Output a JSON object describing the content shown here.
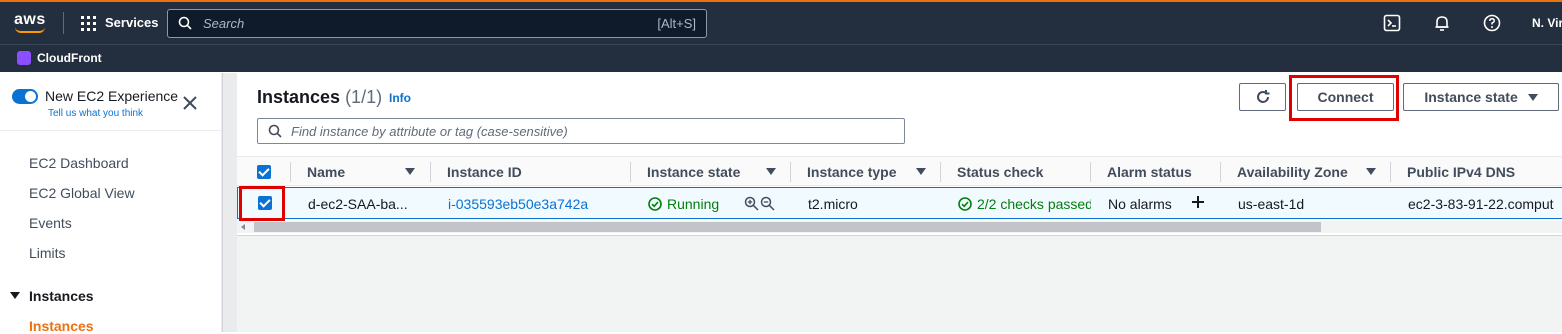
{
  "topbar": {
    "logo": "aws",
    "services_label": "Services",
    "search_placeholder": "Search",
    "search_shortcut": "[Alt+S]",
    "region": "N. Vir",
    "service_favorite": "CloudFront"
  },
  "sidebar": {
    "experience_title": "New EC2 Experience",
    "experience_link": "Tell us what you think",
    "items": [
      "EC2 Dashboard",
      "EC2 Global View",
      "Events",
      "Limits"
    ],
    "section": "Instances",
    "active_item": "Instances"
  },
  "main": {
    "title": "Instances",
    "count": "(1/1)",
    "info": "Info",
    "connect_label": "Connect",
    "instance_state_label": "Instance state",
    "filter_placeholder": "Find instance by attribute or tag (case-sensitive)",
    "columns": [
      "Name",
      "Instance ID",
      "Instance state",
      "Instance type",
      "Status check",
      "Alarm status",
      "Availability Zone",
      "Public IPv4 DNS"
    ],
    "row": {
      "name": "d-ec2-SAA-ba...",
      "instance_id": "i-035593eb50e3a742a",
      "state": "Running",
      "type": "t2.micro",
      "status_check": "2/2 checks passed",
      "alarm": "No alarms",
      "az": "us-east-1d",
      "dns": "ec2-3-83-91-22.comput"
    }
  },
  "colors": {
    "accent": "#0972d3",
    "nav_bg": "#232f3e",
    "success": "#037f0c",
    "active_nav": "#ec7211",
    "highlight": "#e00000"
  }
}
